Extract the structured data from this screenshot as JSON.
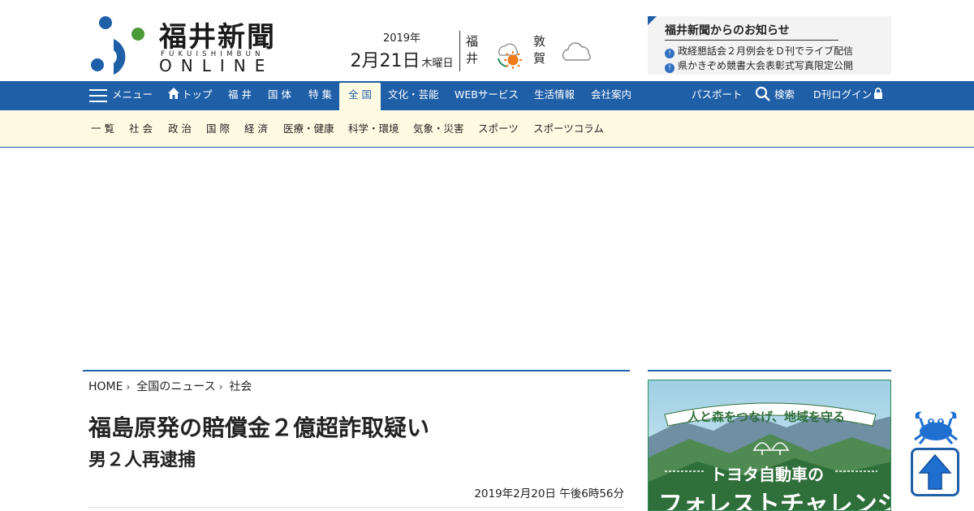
{
  "logo": {
    "name_jp": "福井新聞",
    "name_en": "FUKUISHIMBUN",
    "name_online": "ONLINE"
  },
  "date": {
    "year": "2019年",
    "day": "2月21日",
    "weekday": "木曜日"
  },
  "weather": [
    {
      "city": "福井",
      "icon": "cloud-then-sun-icon"
    },
    {
      "city": "敦賀",
      "icon": "cloud-icon"
    }
  ],
  "notice": {
    "title": "福井新聞からのお知らせ",
    "items": [
      "政経懇話会２月例会をＤ刊でライブ配信",
      "県かきぞめ競書大会表彰式写真限定公開"
    ]
  },
  "nav": {
    "menu": "メニュー",
    "items": [
      "トップ",
      "福 井",
      "国 体",
      "特 集",
      "全 国",
      "文化・芸能",
      "WEBサービス",
      "生活情報",
      "会社案内"
    ],
    "active": "全 国",
    "right": {
      "passport": "パスポート",
      "search": "検索",
      "login": "D刊ログイン"
    }
  },
  "subnav": {
    "items": [
      "一 覧",
      "社 会",
      "政 治",
      "国 際",
      "経 済",
      "医療・健康",
      "科学・環境",
      "気象・災害",
      "スポーツ",
      "スポーツコラム"
    ]
  },
  "breadcrumb": [
    "HOME",
    "全国のニュース",
    "社会"
  ],
  "article": {
    "headline": "福島原発の賠償金２億超詐取疑い",
    "subheadline": "男２人再逮捕",
    "timestamp": "2019年2月20日 午後6時56分"
  },
  "side_ad": {
    "banner": "人と森をつなげ、地域を守る",
    "sponsor": "トヨタ自動車の",
    "title": "フォレストチャレンジ"
  },
  "colors": {
    "nav_blue": "#1f5fa8",
    "subnav_bg": "#fffbe3",
    "logo_blue": "#1f5fa8",
    "logo_green": "#4a9a3a"
  }
}
